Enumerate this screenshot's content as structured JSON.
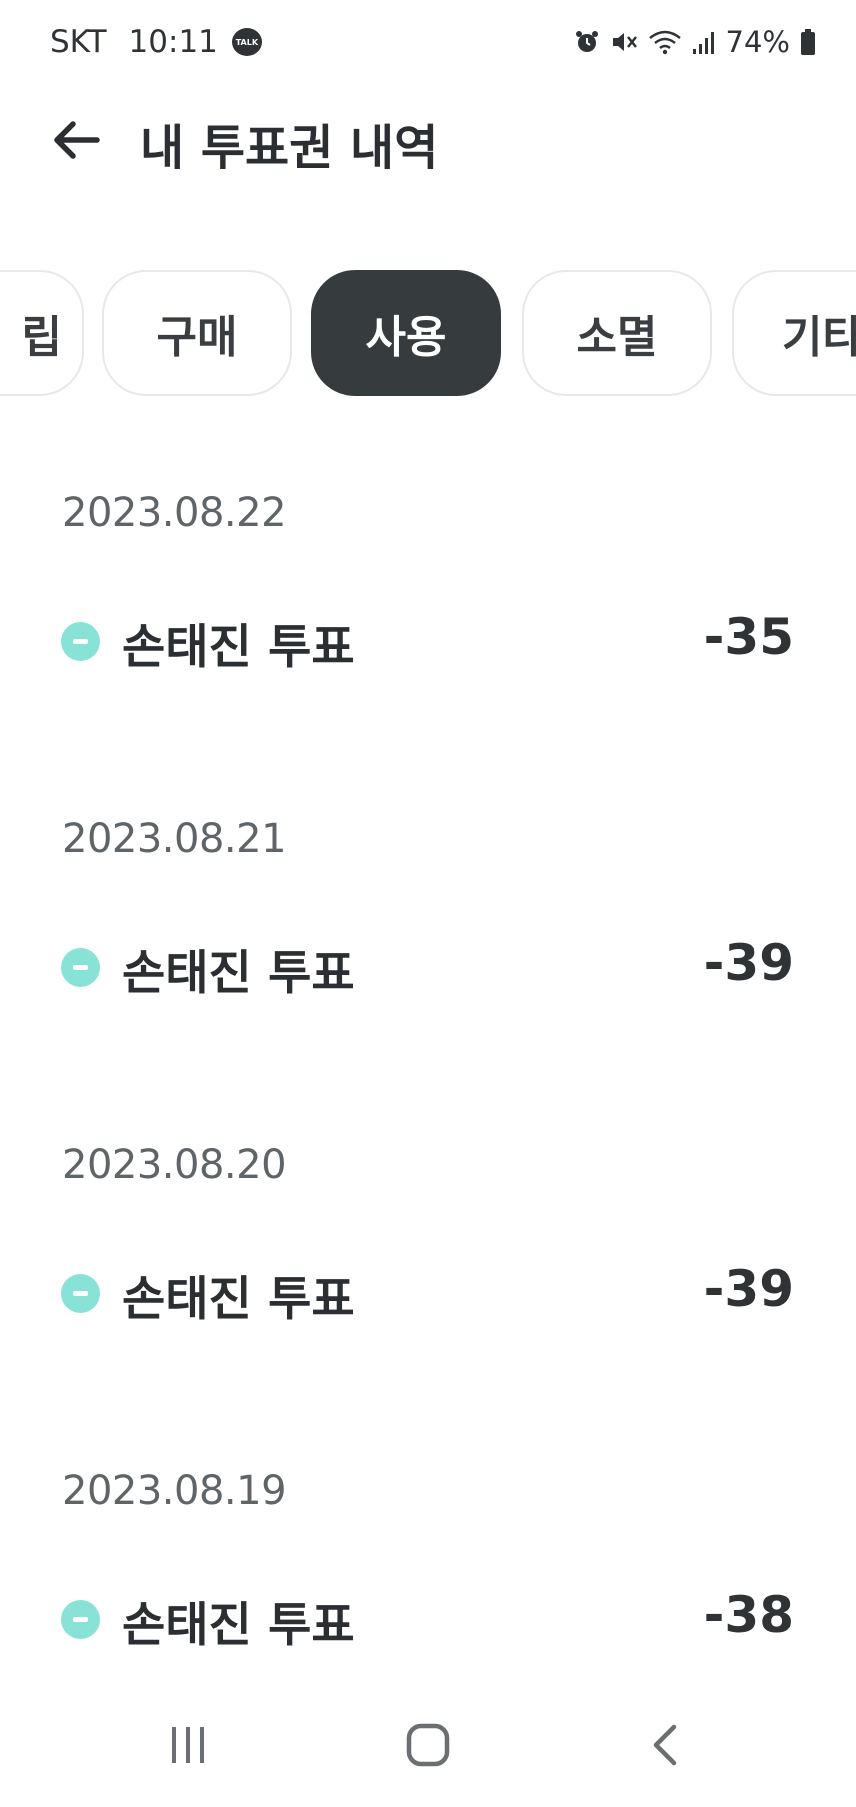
{
  "status_bar": {
    "carrier": "SKT",
    "time": "10:11",
    "talk_badge": "TALK",
    "battery": "74%",
    "icons": [
      "kakao-talk-icon",
      "alarm-icon",
      "mute-icon",
      "wifi-icon",
      "signal-icon",
      "battery-icon"
    ]
  },
  "header": {
    "back_icon": "arrow-left-icon",
    "title": "내 투표권 내역"
  },
  "tabs": [
    {
      "label": "립",
      "active": false
    },
    {
      "label": "구매",
      "active": false
    },
    {
      "label": "사용",
      "active": true
    },
    {
      "label": "소멸",
      "active": false
    },
    {
      "label": "기타",
      "active": false
    }
  ],
  "history": [
    {
      "date": "2023.08.22",
      "label": "손태진 투표",
      "amount": "-35"
    },
    {
      "date": "2023.08.21",
      "label": "손태진 투표",
      "amount": "-39"
    },
    {
      "date": "2023.08.20",
      "label": "손태진 투표",
      "amount": "-39"
    },
    {
      "date": "2023.08.19",
      "label": "손태진 투표",
      "amount": "-38"
    }
  ],
  "colors": {
    "active_tab": "#363b3e",
    "minus_icon": "#88e3d6",
    "text_primary": "#2b2f33",
    "text_secondary": "#5e6468"
  },
  "nav_bar": {
    "icons": [
      "recent-apps-icon",
      "home-icon",
      "back-icon"
    ]
  }
}
